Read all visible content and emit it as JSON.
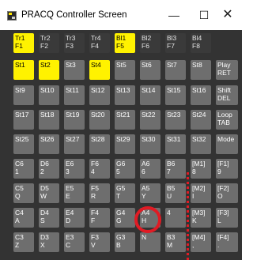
{
  "window": {
    "title": "PRACQ Controller Screen",
    "controls": {
      "minimize": "—",
      "maximize": "☐",
      "close": "✕"
    }
  },
  "colors": {
    "background": "#333333",
    "key": "#6e6e6e",
    "key_active": "#fff200",
    "key_inactive_top": "#3a3a3a",
    "annotation": "#e01b24"
  },
  "tracks": [
    {
      "l1": "Tr1",
      "l2": "F1",
      "active": true
    },
    {
      "l1": "Tr2",
      "l2": "F2",
      "active": false
    },
    {
      "l1": "Tr3",
      "l2": "F3",
      "active": false
    },
    {
      "l1": "Tr4",
      "l2": "F4",
      "active": false
    },
    {
      "l1": "Bl1",
      "l2": "F5",
      "active": true
    },
    {
      "l1": "Bl2",
      "l2": "F6",
      "active": false
    },
    {
      "l1": "Bl3",
      "l2": "F7",
      "active": false
    },
    {
      "l1": "Bl4",
      "l2": "F8",
      "active": false
    }
  ],
  "steps": [
    [
      {
        "l1": "St1",
        "l2": "",
        "active": true
      },
      {
        "l1": "St2",
        "l2": "",
        "active": true
      },
      {
        "l1": "St3",
        "l2": "",
        "active": false
      },
      {
        "l1": "St4",
        "l2": "",
        "active": true
      },
      {
        "l1": "St5",
        "l2": "",
        "active": false
      },
      {
        "l1": "St6",
        "l2": "",
        "active": false
      },
      {
        "l1": "St7",
        "l2": "",
        "active": false
      },
      {
        "l1": "St8",
        "l2": "",
        "active": false
      },
      {
        "l1": "Play",
        "l2": "RET",
        "active": false
      }
    ],
    [
      {
        "l1": "St9",
        "l2": "",
        "active": false
      },
      {
        "l1": "St10",
        "l2": "",
        "active": false
      },
      {
        "l1": "St11",
        "l2": "",
        "active": false
      },
      {
        "l1": "St12",
        "l2": "",
        "active": false
      },
      {
        "l1": "St13",
        "l2": "",
        "active": false
      },
      {
        "l1": "St14",
        "l2": "",
        "active": false
      },
      {
        "l1": "St15",
        "l2": "",
        "active": false
      },
      {
        "l1": "St16",
        "l2": "",
        "active": false
      },
      {
        "l1": "Shift",
        "l2": "DEL",
        "active": false
      }
    ],
    [
      {
        "l1": "St17",
        "l2": "",
        "active": false
      },
      {
        "l1": "St18",
        "l2": "",
        "active": false
      },
      {
        "l1": "St19",
        "l2": "",
        "active": false
      },
      {
        "l1": "St20",
        "l2": "",
        "active": false
      },
      {
        "l1": "St21",
        "l2": "",
        "active": false
      },
      {
        "l1": "St22",
        "l2": "",
        "active": false
      },
      {
        "l1": "St23",
        "l2": "",
        "active": false
      },
      {
        "l1": "St24",
        "l2": "",
        "active": false
      },
      {
        "l1": "Loop",
        "l2": "TAB",
        "active": false
      }
    ],
    [
      {
        "l1": "St25",
        "l2": "",
        "active": false
      },
      {
        "l1": "St26",
        "l2": "",
        "active": false
      },
      {
        "l1": "St27",
        "l2": "",
        "active": false
      },
      {
        "l1": "St28",
        "l2": "",
        "active": false
      },
      {
        "l1": "St29",
        "l2": "",
        "active": false
      },
      {
        "l1": "St30",
        "l2": "",
        "active": false
      },
      {
        "l1": "St31",
        "l2": "",
        "active": false
      },
      {
        "l1": "St32",
        "l2": "",
        "active": false
      },
      {
        "l1": "Mode",
        "l2": "",
        "active": false
      }
    ]
  ],
  "notes": [
    [
      {
        "l1": "C6",
        "l2": "1"
      },
      {
        "l1": "D6",
        "l2": "2"
      },
      {
        "l1": "E6",
        "l2": "3"
      },
      {
        "l1": "F6",
        "l2": "4"
      },
      {
        "l1": "G6",
        "l2": "5"
      },
      {
        "l1": "A6",
        "l2": "6"
      },
      {
        "l1": "B6",
        "l2": "7"
      },
      {
        "l1": "[M1]",
        "l2": "8"
      },
      {
        "l1": "[F1]",
        "l2": "9"
      }
    ],
    [
      {
        "l1": "C5",
        "l2": "Q"
      },
      {
        "l1": "D5",
        "l2": "W"
      },
      {
        "l1": "E5",
        "l2": "E"
      },
      {
        "l1": "F5",
        "l2": "R"
      },
      {
        "l1": "G5",
        "l2": "T"
      },
      {
        "l1": "A5",
        "l2": "Y"
      },
      {
        "l1": "B5",
        "l2": "U"
      },
      {
        "l1": "[M2]",
        "l2": "I"
      },
      {
        "l1": "[F2]",
        "l2": "O"
      }
    ],
    [
      {
        "l1": "C4",
        "l2": "A"
      },
      {
        "l1": "D4",
        "l2": "S"
      },
      {
        "l1": "E4",
        "l2": "D"
      },
      {
        "l1": "F4",
        "l2": "F"
      },
      {
        "l1": "G4",
        "l2": "G"
      },
      {
        "l1": "A4",
        "l2": "H"
      },
      {
        "l1": "4",
        "l2": ""
      },
      {
        "l1": "[M3]",
        "l2": "K"
      },
      {
        "l1": "[F3]",
        "l2": "L"
      }
    ],
    [
      {
        "l1": "C3",
        "l2": "Z"
      },
      {
        "l1": "D3",
        "l2": "X"
      },
      {
        "l1": "E3",
        "l2": "C"
      },
      {
        "l1": "F3",
        "l2": "V"
      },
      {
        "l1": "G3",
        "l2": "B"
      },
      {
        "l1": "",
        "l2": "N"
      },
      {
        "l1": "B3",
        "l2": "M"
      },
      {
        "l1": "[M4]",
        "l2": ","
      },
      {
        "l1": "[F4]",
        "l2": "."
      }
    ]
  ]
}
